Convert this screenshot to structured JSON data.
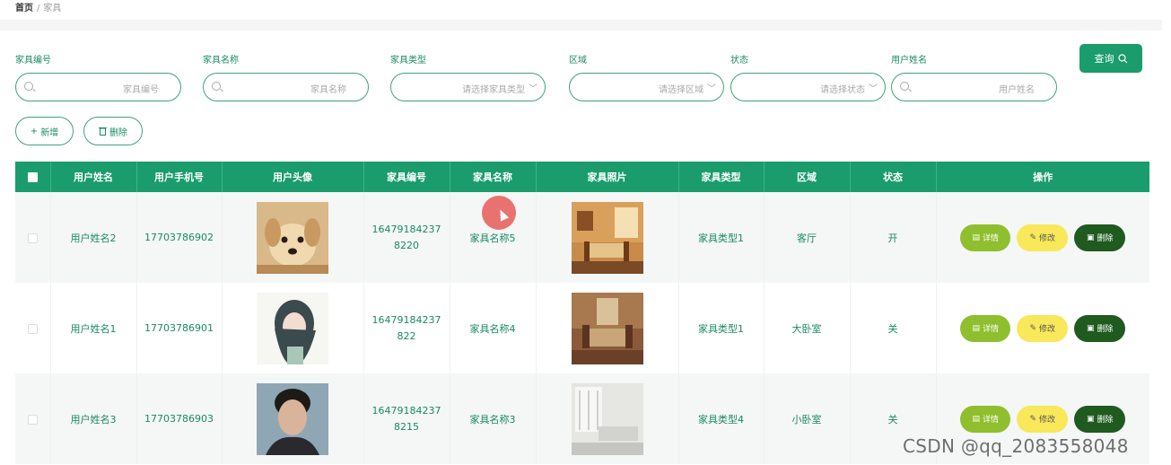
{
  "breadcrumb": {
    "home": "首页",
    "separator": "/",
    "current": "家具"
  },
  "filters": {
    "furniture_no": {
      "label": "家具编号",
      "placeholder": "家具编号"
    },
    "furniture_name": {
      "label": "家具名称",
      "placeholder": "家具名称"
    },
    "furniture_type": {
      "label": "家具类型",
      "placeholder": "请选择家具类型"
    },
    "area": {
      "label": "区域",
      "placeholder": "请选择区域"
    },
    "status": {
      "label": "状态",
      "placeholder": "请选择状态"
    },
    "username": {
      "label": "用户姓名",
      "placeholder": "用户姓名"
    },
    "query_button": "查询"
  },
  "actions": {
    "add_label": "新增",
    "delete_label": "删除"
  },
  "table": {
    "columns": [
      "用户姓名",
      "用户手机号",
      "用户头像",
      "家具编号",
      "家具名称",
      "家具照片",
      "家具类型",
      "区域",
      "状态",
      "操作"
    ],
    "rows": [
      {
        "username": "用户姓名2",
        "phone": "17703786902",
        "avatar": "puppy-photo",
        "no_line1": "16479184237",
        "no_line2": "8220",
        "name": "家具名称5",
        "photo": "living-room-photo",
        "type": "家具类型1",
        "area": "客厅",
        "status": "开"
      },
      {
        "username": "用户姓名1",
        "phone": "17703786901",
        "avatar": "anime-girl-photo",
        "no_line1": "16479184237",
        "no_line2": "822",
        "name": "家具名称4",
        "photo": "sofa-room-photo",
        "type": "家具类型1",
        "area": "大卧室",
        "status": "关"
      },
      {
        "username": "用户姓名3",
        "phone": "17703786903",
        "avatar": "man-portrait-photo",
        "no_line1": "16479184237",
        "no_line2": "8215",
        "name": "家具名称3",
        "photo": "white-room-photo",
        "type": "家具类型4",
        "area": "小卧室",
        "status": "关"
      }
    ],
    "row_actions": {
      "detail": "详情",
      "edit": "修改",
      "delete": "删除"
    }
  },
  "watermark": "CSDN @qq_2083558048",
  "colors": {
    "primary": "#1a9c6c",
    "text_green": "#1a8a63",
    "detail": "#8fbf2e",
    "edit": "#f8e85a",
    "delete": "#1f5a1e"
  }
}
